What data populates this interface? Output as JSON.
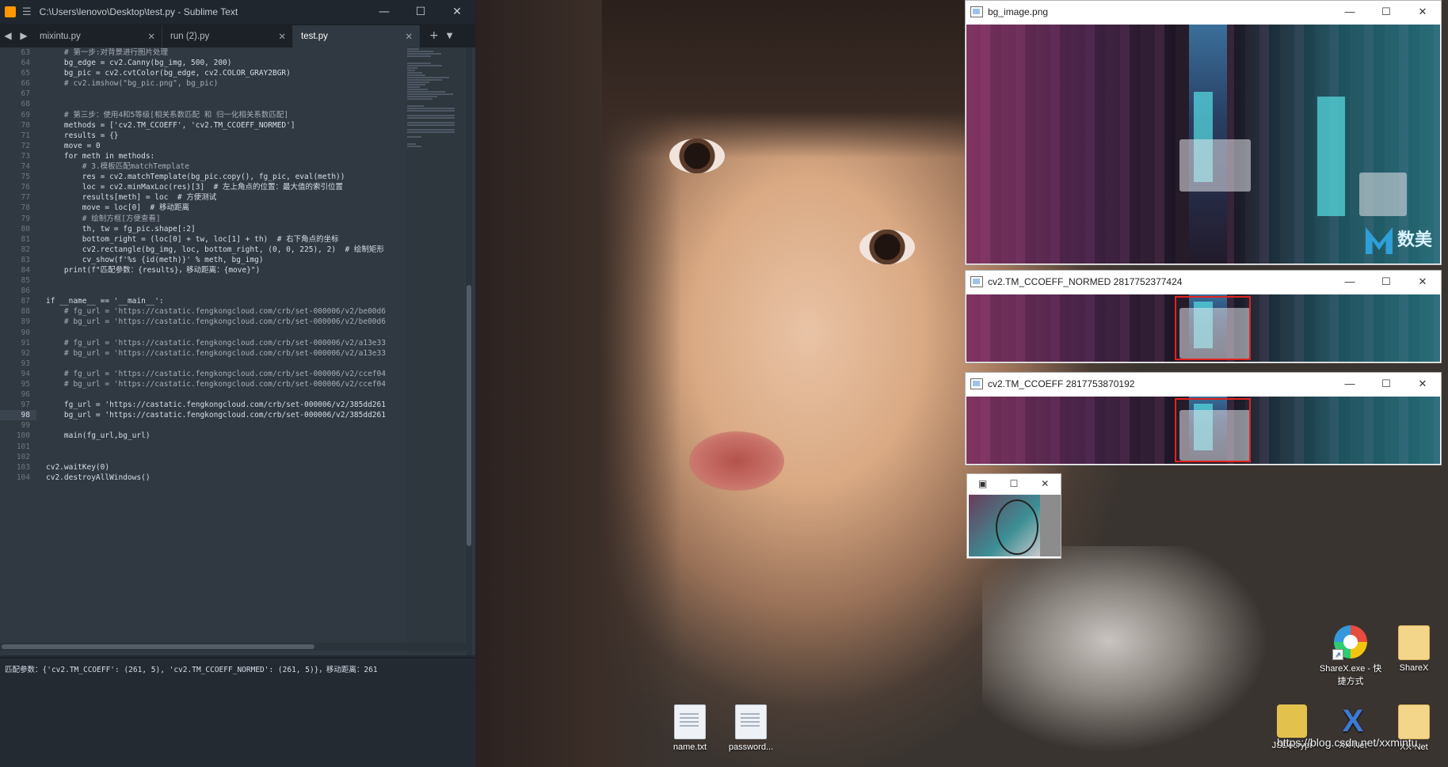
{
  "sublime": {
    "title": "C:\\Users\\lenovo\\Desktop\\test.py - Sublime Text",
    "tabs": [
      {
        "label": "mixintu.py",
        "active": false
      },
      {
        "label": "run (2).py",
        "active": false
      },
      {
        "label": "test.py",
        "active": true
      }
    ],
    "line_numbers": [
      "63",
      "64",
      "65",
      "66",
      "67",
      "68",
      "69",
      "70",
      "71",
      "72",
      "73",
      "74",
      "75",
      "76",
      "77",
      "78",
      "79",
      "80",
      "81",
      "82",
      "83",
      "84",
      "85",
      "86",
      "87",
      "88",
      "89",
      "90",
      "91",
      "92",
      "93",
      "94",
      "95",
      "96",
      "97",
      "98",
      "99",
      "100",
      "101",
      "102",
      "103",
      "104"
    ],
    "current_line": "98",
    "code_lines": [
      "    # 第一步:对背景进行图片处理",
      "    bg_edge = cv2.Canny(bg_img, 500, 200)",
      "    bg_pic = cv2.cvtColor(bg_edge, cv2.COLOR_GRAY2BGR)",
      "    # cv2.imshow(\"bg_pic.png\", bg_pic)",
      "",
      "",
      "    # 第三步：使用4和5等级[相关系数匹配 和 归一化相关系数匹配]",
      "    methods = ['cv2.TM_CCOEFF', 'cv2.TM_CCOEFF_NORMED']",
      "    results = {}",
      "    move = 0",
      "    for meth in methods:",
      "        # 3.模板匹配matchTemplate",
      "        res = cv2.matchTemplate(bg_pic.copy(), fg_pic, eval(meth))",
      "        loc = cv2.minMaxLoc(res)[3]  # 左上角点的位置：最大值的索引位置",
      "        results[meth] = loc  # 方便测试",
      "        move = loc[0]  # 移动距离",
      "        # 绘制方框[方便查看]",
      "        th, tw = fg_pic.shape[:2]",
      "        bottom_right = (loc[0] + tw, loc[1] + th)  # 右下角点的坐标",
      "        cv2.rectangle(bg_img, loc, bottom_right, (0, 0, 225), 2)  # 绘制矩形",
      "        cv_show(f'%s {id(meth)}' % meth, bg_img)",
      "    print(f\"匹配参数：{results}，移动距离：{move}\")",
      "",
      "",
      "if __name__ == '__main__':",
      "    # fg_url = 'https://castatic.fengkongcloud.com/crb/set-000006/v2/be00d6",
      "    # bg_url = 'https://castatic.fengkongcloud.com/crb/set-000006/v2/be00d6",
      "",
      "    # fg_url = 'https://castatic.fengkongcloud.com/crb/set-000006/v2/a13e33",
      "    # bg_url = 'https://castatic.fengkongcloud.com/crb/set-000006/v2/a13e33",
      "",
      "    # fg_url = 'https://castatic.fengkongcloud.com/crb/set-000006/v2/ccef04",
      "    # bg_url = 'https://castatic.fengkongcloud.com/crb/set-000006/v2/ccef04",
      "",
      "    fg_url = 'https://castatic.fengkongcloud.com/crb/set-000006/v2/385dd261",
      "    bg_url = 'https://castatic.fengkongcloud.com/crb/set-000006/v2/385dd261",
      "",
      "    main(fg_url,bg_url)",
      "",
      "",
      "cv2.waitKey(0)",
      "cv2.destroyAllWindows()"
    ],
    "console_output": "匹配参数：{'cv2.TM_CCOEFF': (261, 5), 'cv2.TM_CCOEFF_NORMED': (261, 5)}，移动距离：261"
  },
  "cv_windows": {
    "bg_image_title": "bg_image.png",
    "normed_title": "cv2.TM_CCOEFF_NORMED 2817752377424",
    "ccoeff_title": "cv2.TM_CCOEFF 2817753870192",
    "logo_text": "数美",
    "controls": {
      "minimize": "—",
      "maximize": "☐",
      "close": "✕"
    }
  },
  "desktop_icons": [
    {
      "label": "ShareX.exe - 快捷方式",
      "icon": "sharex-icon"
    },
    {
      "label": "ShareX",
      "icon": "folder-icon"
    },
    {
      "label": "name.txt",
      "icon": "text-file-icon"
    },
    {
      "label": "password...",
      "icon": "text-file-icon"
    },
    {
      "label": "JSDecrypt",
      "icon": "lock-file-icon"
    },
    {
      "label": "XX-Net",
      "icon": "xx-net-icon"
    },
    {
      "label": "XX-Net",
      "icon": "folder-icon"
    }
  ],
  "watermark": "https://blog.csdn.net/xxmintu",
  "colors": {
    "red_box": "#e0231e",
    "editor_bg": "#303841"
  }
}
